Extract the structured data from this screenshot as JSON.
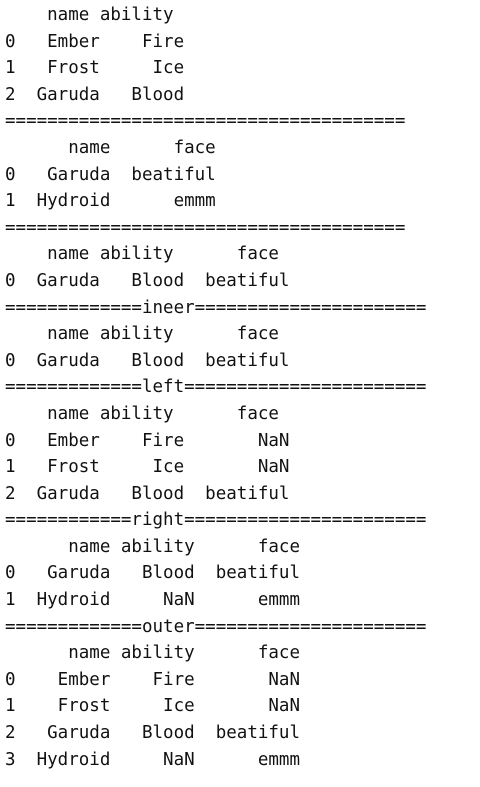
{
  "output_lines": [
    "    name ability",
    "0   Ember    Fire",
    "1   Frost     Ice",
    "2  Garuda   Blood",
    "======================================",
    "      name      face",
    "0   Garuda  beatiful",
    "1  Hydroid      emmm",
    "======================================",
    "    name ability      face",
    "0  Garuda   Blood  beatiful",
    "=============ineer======================",
    "    name ability      face",
    "0  Garuda   Blood  beatiful",
    "=============left=======================",
    "    name ability      face",
    "0   Ember    Fire       NaN",
    "1   Frost     Ice       NaN",
    "2  Garuda   Blood  beatiful",
    "============right=======================",
    "      name ability      face",
    "0   Garuda   Blood  beatiful",
    "1  Hydroid     NaN      emmm",
    "=============outer======================",
    "      name ability      face",
    "0    Ember    Fire       NaN",
    "1    Frost     Ice       NaN",
    "2   Garuda   Blood  beatiful",
    "3  Hydroid     NaN      emmm"
  ]
}
